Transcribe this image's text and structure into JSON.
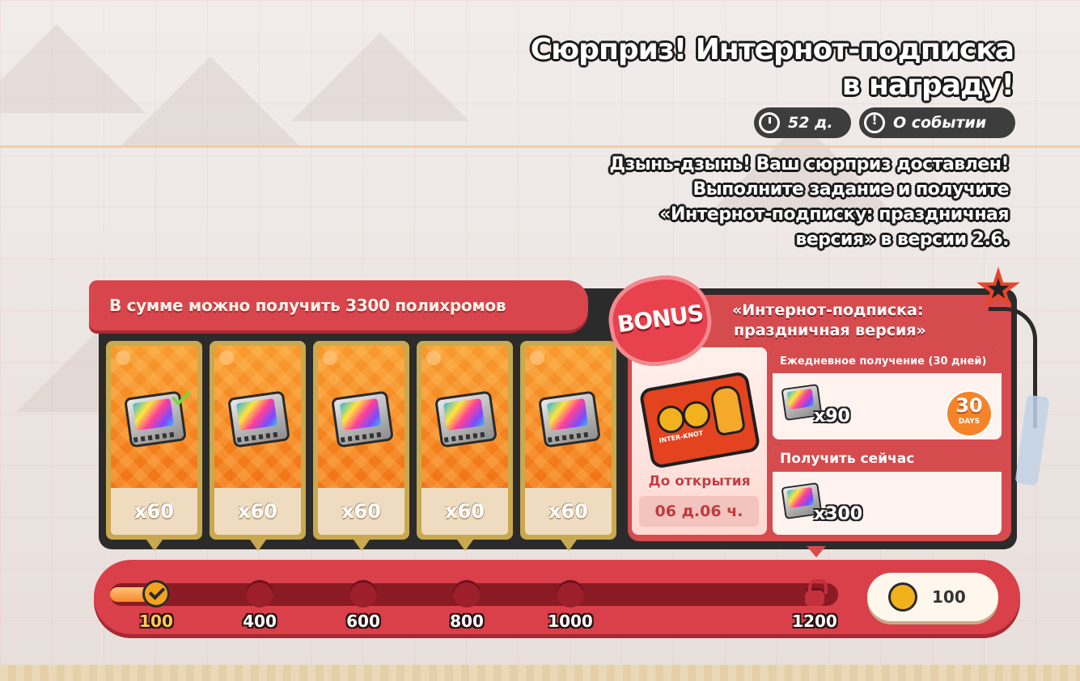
{
  "header": {
    "title_line1": "Сюрприз! Интернот-подписка",
    "title_line2": "в награду!",
    "timer": "52 д.",
    "about_label": "О событии",
    "description": [
      "Дзынь-дзынь! Ваш сюрприз доставлен!",
      "Выполните задание и получите",
      "«Интернот-подписку: праздничная",
      "версия» в версии 2.6."
    ]
  },
  "total_banner": "В сумме можно получить 3300 полихромов",
  "reward_cards": [
    {
      "amount": "x60",
      "claimed": true
    },
    {
      "amount": "x60",
      "claimed": false
    },
    {
      "amount": "x60",
      "claimed": false
    },
    {
      "amount": "x60",
      "claimed": false
    },
    {
      "amount": "x60",
      "claimed": false
    }
  ],
  "bonus": {
    "badge": "BONUS",
    "title_line1": "«Интернот-подписка:",
    "title_line2": "праздничная версия»",
    "chest_label": "INTER-KNOT",
    "open_label": "До открытия",
    "open_time": "06 д.06 ч.",
    "daily_header": "Ежедневное получение (30 дней)",
    "daily_amount": "x90",
    "days_number": "30",
    "days_word": "DAYS",
    "now_header": "Получить сейчас",
    "now_amount": "x300"
  },
  "progress": {
    "current_points": "100",
    "fill_fraction": 0.06,
    "milestones": [
      {
        "label": "100",
        "state": "done"
      },
      {
        "label": "400",
        "state": "open"
      },
      {
        "label": "600",
        "state": "open"
      },
      {
        "label": "800",
        "state": "open"
      },
      {
        "label": "1000",
        "state": "open"
      },
      {
        "label": "1200",
        "state": "locked"
      }
    ]
  },
  "colors": {
    "accent_red": "#d54b4e",
    "card_orange": "#f27617",
    "card_gold": "#c9a94f",
    "check_green": "#7bd63a"
  }
}
